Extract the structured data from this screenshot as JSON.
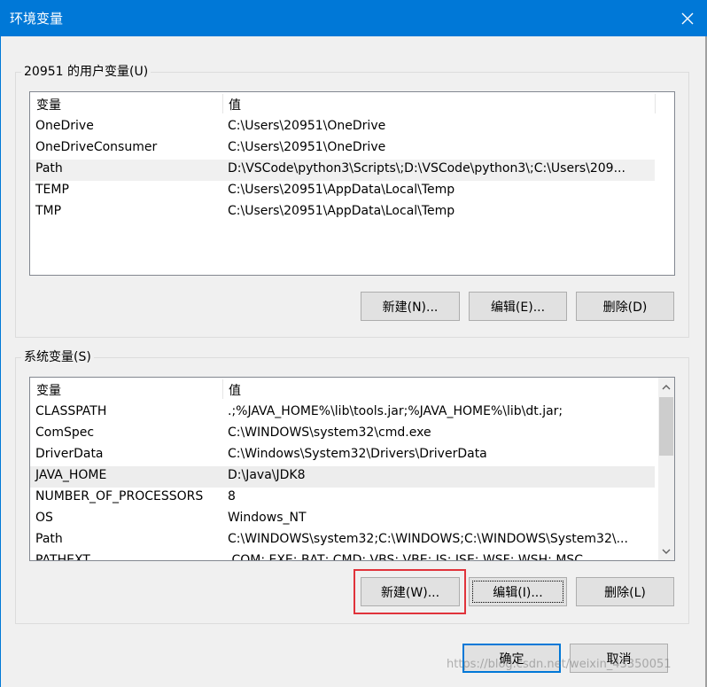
{
  "window": {
    "title": "环境变量",
    "accent_color": "#0078d7",
    "close_icon": "close-icon"
  },
  "user_vars": {
    "legend": "20951 的用户变量(U)",
    "columns": [
      "变量",
      "值"
    ],
    "rows": [
      {
        "name": "OneDrive",
        "value": "C:\\Users\\20951\\OneDrive"
      },
      {
        "name": "OneDriveConsumer",
        "value": "C:\\Users\\20951\\OneDrive"
      },
      {
        "name": "Path",
        "value": "D:\\VSCode\\python3\\Scripts\\;D:\\VSCode\\python3\\;C:\\Users\\209..."
      },
      {
        "name": "TEMP",
        "value": "C:\\Users\\20951\\AppData\\Local\\Temp"
      },
      {
        "name": "TMP",
        "value": "C:\\Users\\20951\\AppData\\Local\\Temp"
      }
    ],
    "selected": "Path",
    "buttons": {
      "new": "新建(N)...",
      "edit": "编辑(E)...",
      "delete": "删除(D)"
    }
  },
  "sys_vars": {
    "legend": "系统变量(S)",
    "columns": [
      "变量",
      "值"
    ],
    "rows": [
      {
        "name": "CLASSPATH",
        "value": ".;%JAVA_HOME%\\lib\\tools.jar;%JAVA_HOME%\\lib\\dt.jar;"
      },
      {
        "name": "ComSpec",
        "value": "C:\\WINDOWS\\system32\\cmd.exe"
      },
      {
        "name": "DriverData",
        "value": "C:\\Windows\\System32\\Drivers\\DriverData"
      },
      {
        "name": "JAVA_HOME",
        "value": "D:\\Java\\JDK8"
      },
      {
        "name": "NUMBER_OF_PROCESSORS",
        "value": "8"
      },
      {
        "name": "OS",
        "value": "Windows_NT"
      },
      {
        "name": "Path",
        "value": "C:\\WINDOWS\\system32;C:\\WINDOWS;C:\\WINDOWS\\System32\\..."
      },
      {
        "name": "PATHEXT",
        "value": ".COM;.EXE;.BAT;.CMD;.VBS;.VBE;.JS;.JSE;.WSF;.WSH;.MSC"
      }
    ],
    "selected": "JAVA_HOME",
    "buttons": {
      "new": "新建(W)...",
      "edit": "编辑(I)...",
      "delete": "删除(L)"
    }
  },
  "footer": {
    "ok": "确定",
    "cancel": "取消",
    "watermark": "https://blog.csdn.net/weixin_43350051"
  },
  "annotation_color": "#e0333b"
}
